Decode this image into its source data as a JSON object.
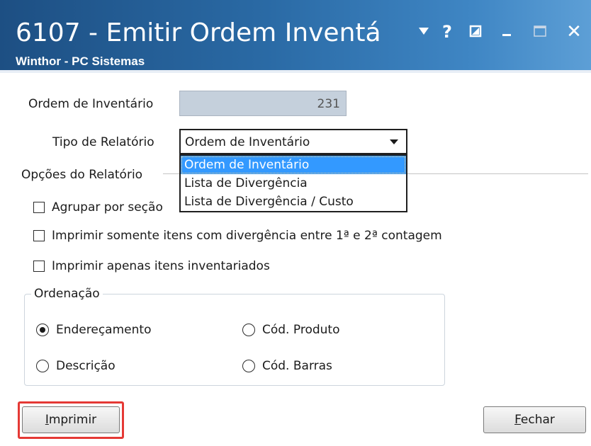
{
  "window": {
    "title": "6107 - Emitir Ordem Inventá",
    "subtitle": "Winthor - PC Sistemas"
  },
  "titlebar_buttons": [
    "dropdown-arrow",
    "help",
    "restore",
    "minimize",
    "maximize",
    "close"
  ],
  "titlebar_labels": {
    "help": "?",
    "close": "✕"
  },
  "form": {
    "ordem_label": "Ordem de Inventário",
    "ordem_value": "231",
    "tipo_label": "Tipo de Relatório",
    "tipo_selected": "Ordem de Inventário",
    "tipo_options": [
      "Ordem de Inventário",
      "Lista de Divergência",
      "Lista de Divergência / Custo"
    ]
  },
  "opcoes": {
    "title": "Opções do Relatório",
    "agrupar": "Agrupar por seção",
    "somente_divergencia": "Imprimir somente itens com divergência entre 1ª e 2ª contagem",
    "apenas_inventariados": "Imprimir apenas itens inventariados"
  },
  "ordenacao": {
    "title": "Ordenação",
    "enderecamento": "Endereçamento",
    "cod_produto": "Cód. Produto",
    "descricao": "Descrição",
    "cod_barras": "Cód. Barras",
    "selected": "Endereçamento"
  },
  "buttons": {
    "imprimir_first": "I",
    "imprimir_rest": "mprimir",
    "fechar_first": "F",
    "fechar_rest": "echar"
  },
  "colors": {
    "titlebar": "#2a6aa5",
    "selection": "#3399ff",
    "highlight": "#e53935"
  }
}
